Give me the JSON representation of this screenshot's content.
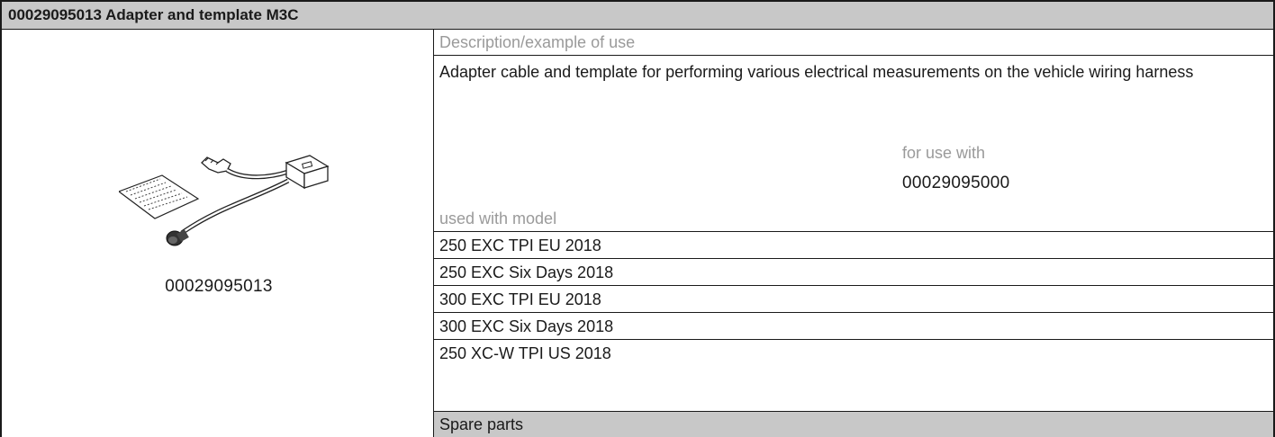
{
  "header": {
    "title": "00029095013 Adapter and template M3C"
  },
  "tool": {
    "part_number": "00029095013",
    "image_icon": "adapter-cable-and-template-illustration"
  },
  "description": {
    "label": "Description/example of use",
    "text": "Adapter cable and template for performing various electrical measurements on the vehicle wiring harness"
  },
  "for_use": {
    "label": "for use with",
    "value": "00029095000"
  },
  "models": {
    "label": "used with model",
    "items": [
      "250 EXC TPI EU 2018",
      "250 EXC Six Days 2018",
      "300 EXC TPI EU 2018",
      "300 EXC Six Days 2018",
      "250 XC-W TPI US 2018"
    ]
  },
  "spare_parts": {
    "label": "Spare parts"
  },
  "colors": {
    "header_bg": "#c8c8c8",
    "label_gray": "#9a9a9a",
    "border": "#1a1a1a"
  }
}
